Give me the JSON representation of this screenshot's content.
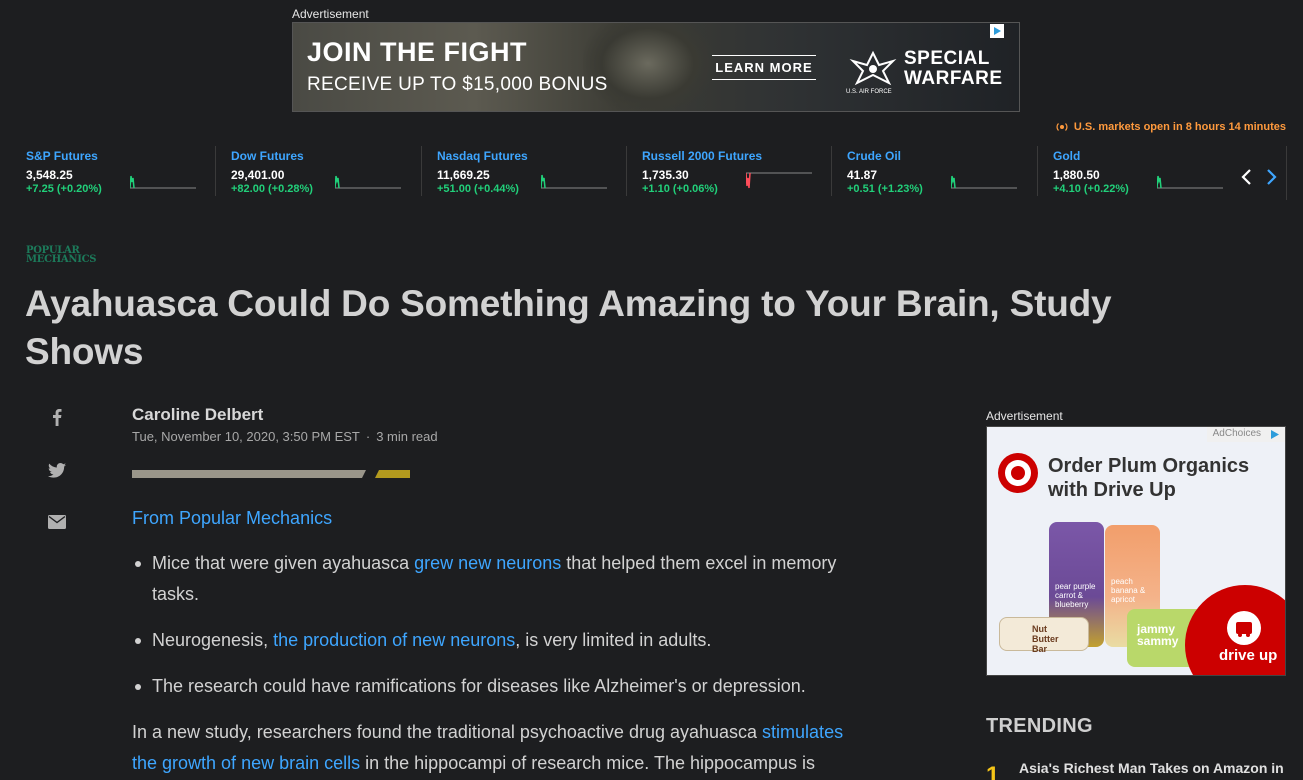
{
  "top_ad": {
    "label": "Advertisement",
    "headline": "JOIN THE FIGHT",
    "subline": "RECEIVE UP TO $15,000 BONUS",
    "cta": "LEARN MORE",
    "brand_small": "U.S. AIR FORCE",
    "brand_line1": "SPECIAL",
    "brand_line2": "WARFARE"
  },
  "market_status": "U.S. markets open in 8 hours 14 minutes",
  "tickers": [
    {
      "name": "S&P Futures",
      "value": "3,548.25",
      "change": "+7.25 (+0.20%)",
      "direction": "up"
    },
    {
      "name": "Dow Futures",
      "value": "29,401.00",
      "change": "+82.00 (+0.28%)",
      "direction": "up"
    },
    {
      "name": "Nasdaq Futures",
      "value": "11,669.25",
      "change": "+51.00 (+0.44%)",
      "direction": "up"
    },
    {
      "name": "Russell 2000 Futures",
      "value": "1,735.30",
      "change": "+1.10 (+0.06%)",
      "direction": "down"
    },
    {
      "name": "Crude Oil",
      "value": "41.87",
      "change": "+0.51 (+1.23%)",
      "direction": "up"
    },
    {
      "name": "Gold",
      "value": "1,880.50",
      "change": "+4.10 (+0.22%)",
      "direction": "up"
    }
  ],
  "colors": {
    "up": "#21d07a",
    "down": "#ff4d5a",
    "link": "#3ea6ff",
    "accent": "#f5c518",
    "market_status": "#ff9a3d"
  },
  "article": {
    "publisher_line1": "POPULAR",
    "publisher_line2": "MECHANICS",
    "title": "Ayahuasca Could Do Something Amazing to Your Brain, Study Shows",
    "author": "Caroline Delbert",
    "date": "Tue, November 10, 2020, 3:50 PM EST",
    "separator": "·",
    "read_time": "3 min read",
    "source_link": "From Popular Mechanics",
    "bullets": [
      {
        "pre": "Mice that were given ayahuasca ",
        "link": "grew new neurons",
        "post": " that helped them excel in memory tasks."
      },
      {
        "pre": "Neurogenesis, ",
        "link": "the production of new neurons",
        "post": ", is very limited in adults."
      },
      {
        "pre": "The research could have ramifications for diseases like Alzheimer's or depression.",
        "link": "",
        "post": ""
      }
    ],
    "paragraph": {
      "pre": "In a new study, researchers found the traditional psychoactive drug ayahuasca ",
      "link": "stimulates the growth of new brain cells",
      "post": " in the hippocampi of research mice. The hippocampus is"
    }
  },
  "share_icons": [
    "facebook-icon",
    "twitter-icon",
    "mail-icon"
  ],
  "side_ad": {
    "label": "Advertisement",
    "adchoices": "AdChoices",
    "headline_line1": "Order Plum Organics",
    "headline_line2": "with Drive Up",
    "product1": "pear purple carrot & blueberry",
    "product2": "peach banana & apricot",
    "product3": "Nut Butter Bar",
    "product4": "jammy sammy",
    "badge": "drive up"
  },
  "trending": {
    "title": "TRENDING",
    "items": [
      {
        "rank": "1",
        "text": "Asia's Richest Man Takes on Amazon in"
      }
    ]
  }
}
